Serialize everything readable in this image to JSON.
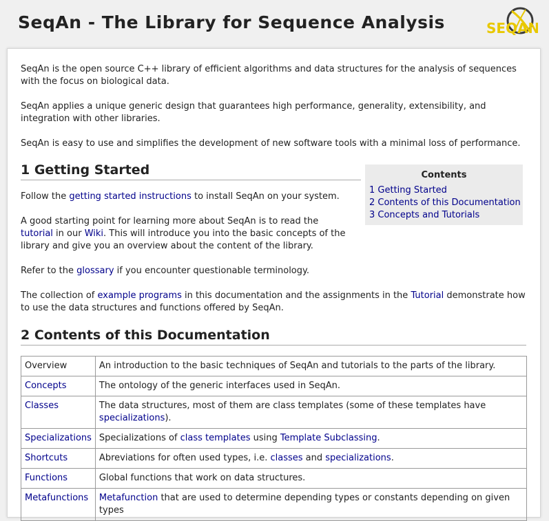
{
  "header": {
    "title": "SeqAn - The Library for Sequence Analysis",
    "logo_text": "SEQAN"
  },
  "intro": {
    "p1": "SeqAn is the open source C++ library of efficient algorithms and data structures for the analysis of sequences with the focus on biological data.",
    "p2": "SeqAn applies a unique generic design that guarantees high performance, generality, extensibility, and integration with other libraries.",
    "p3": "SeqAn is easy to use and simplifies the development of new software tools with a minimal loss of performance."
  },
  "getting_started": {
    "heading": "1 Getting Started",
    "p1_a": "Follow the ",
    "p1_link": "getting started instructions",
    "p1_b": " to install SeqAn on your system.",
    "p2_a": "A good starting point for learning more about SeqAn is to read the ",
    "p2_link1": "tutorial",
    "p2_b": " in our ",
    "p2_link2": "Wiki",
    "p2_c": ". This will introduce you into the basic concepts of the library and give you an overview about the content of the library.",
    "p3_a": "Refer to the ",
    "p3_link": "glossary",
    "p3_b": " if you encounter questionable terminology.",
    "p4_a": "The collection of ",
    "p4_link1": "example programs",
    "p4_b": " in this documentation and the assignments in the ",
    "p4_link2": "Tutorial",
    "p4_c": " demonstrate how to use the data structures and functions offered by SeqAn."
  },
  "toc": {
    "title": "Contents",
    "items": [
      "1 Getting Started",
      "2 Contents of this Documentation",
      "3 Concepts and Tutorials"
    ]
  },
  "contents": {
    "heading": "2 Contents of this Documentation",
    "rows": [
      {
        "name": "Overview",
        "desc": "An introduction to the basic techniques of SeqAn and tutorials to the parts of the library."
      },
      {
        "name": "Concepts",
        "desc": "The ontology of the generic interfaces used in SeqAn."
      },
      {
        "name": "Classes",
        "desc_a": "The data structures, most of them are class templates (some of these templates have ",
        "desc_link": "specializations",
        "desc_b": ")."
      },
      {
        "name": "Specializations",
        "desc_a": "Specializations of ",
        "desc_link1": "class templates",
        "desc_b": " using ",
        "desc_link2": "Template Subclassing",
        "desc_c": "."
      },
      {
        "name": "Shortcuts",
        "desc_a": "Abreviations for often used types, i.e. ",
        "desc_link1": "classes",
        "desc_b": " and ",
        "desc_link2": "specializations",
        "desc_c": "."
      },
      {
        "name": "Functions",
        "desc": "Global functions that work on data structures."
      },
      {
        "name": "Metafunctions",
        "desc_link": "Metafunction",
        "desc_a": " that are used to determine depending types or constants depending on given types"
      }
    ]
  },
  "colors": {
    "link": "#00008b",
    "background": "#f0f0f0",
    "toc_background": "#ebebeb"
  }
}
